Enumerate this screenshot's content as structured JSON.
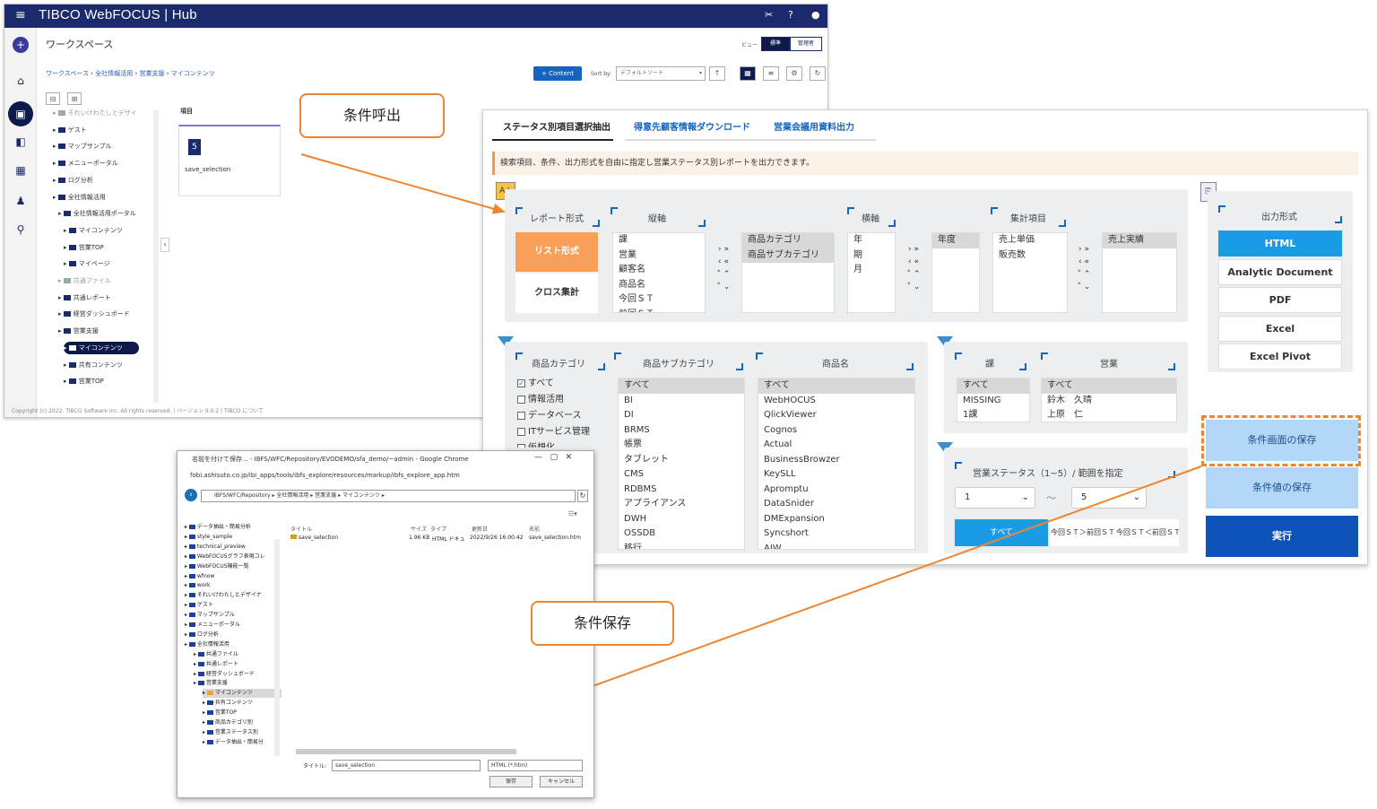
{
  "hub": {
    "brand": "TIBCO WebFOCUS | Hub",
    "workspace_title": "ワークスペース",
    "view_label": "ビュー",
    "view_standard": "標準",
    "view_admin": "管理者",
    "breadcrumb": [
      "ワークスペース",
      "全社情報活用",
      "営業支援",
      "マイコンテンツ"
    ],
    "content_button": "+ Content",
    "sort_label": "Sort by:",
    "sort_value": "デフォルトソート",
    "tree": [
      {
        "label": "それいけわたしとデザイ",
        "level": 1,
        "dim": true
      },
      {
        "label": "ゲスト",
        "level": 1
      },
      {
        "label": "マップサンプル",
        "level": 1
      },
      {
        "label": "メニューポータル",
        "level": 1
      },
      {
        "label": "ログ分析",
        "level": 1
      },
      {
        "label": "全社情報活用",
        "level": 1
      },
      {
        "label": "全社情報活用ポータル",
        "level": 2
      },
      {
        "label": "マイコンテンツ",
        "level": 3
      },
      {
        "label": "営業TOP",
        "level": 3
      },
      {
        "label": "マイページ",
        "level": 3
      },
      {
        "label": "共通ファイル",
        "level": 2,
        "dim": true
      },
      {
        "label": "共通レポート",
        "level": 2
      },
      {
        "label": "経営ダッシュボード",
        "level": 2
      },
      {
        "label": "営業支援",
        "level": 2
      },
      {
        "label": "マイコンテンツ",
        "level": 3,
        "selected": true
      },
      {
        "label": "共有コンテンツ",
        "level": 3
      },
      {
        "label": "営業TOP",
        "level": 3
      }
    ],
    "items_header": "項目",
    "card_icon": "html5-icon",
    "card_name": "save_selection",
    "footer": "Copyright (c) 2022. TIBCO Software Inc. All rights reserved.  |  バージョン 9.0.2  |  TIBCO について"
  },
  "app": {
    "tabs": [
      "ステータス別項目選択抽出",
      "得意先顧客情報ダウンロード",
      "営業会議用資料出力"
    ],
    "description": "検索項目、条件、出力形式を自由に指定し営業ステータス別レポートを出力できます。",
    "report_format_label": "レポート形式",
    "list_format": "リスト形式",
    "cross_format": "クロス集計",
    "vertical_axis_label": "縦軸",
    "vertical_items": [
      "課",
      "営業",
      "顧客名",
      "商品名",
      "今回ＳＴ",
      "前回ＳＴ"
    ],
    "vertical_selected": [
      "商品カテゴリ",
      "商品サブカテゴリ"
    ],
    "horizontal_axis_label": "横軸",
    "horizontal_items": [
      "年",
      "期",
      "月"
    ],
    "horizontal_selected": [
      "年度"
    ],
    "agg_label": "集計項目",
    "agg_items": [
      "売上単価",
      "販売数"
    ],
    "agg_selected": [
      "売上実績"
    ],
    "arrows": [
      "›  »",
      "‹  «",
      "˄  ⌃",
      "˅  ⌄"
    ],
    "output_label": "出力形式",
    "outputs": [
      "HTML",
      "Analytic Document",
      "PDF",
      "Excel",
      "Excel Pivot"
    ],
    "cat_label": "商品カテゴリ",
    "cat_items": [
      {
        "label": "すべて",
        "checked": true
      },
      {
        "label": "情報活用",
        "checked": false
      },
      {
        "label": "データベース",
        "checked": false
      },
      {
        "label": "ITサービス管理",
        "checked": false
      },
      {
        "label": "仮想化",
        "checked": false
      }
    ],
    "subcat_label": "商品サブカテゴリ",
    "subcat_items": [
      "すべて",
      "BI",
      "DI",
      "BRMS",
      "帳票",
      "タブレット",
      "CMS",
      "RDBMS",
      "アプライアンス",
      "DWH",
      "OSSDB",
      "移行"
    ],
    "product_label": "商品名",
    "product_items": [
      "すべて",
      "WebHOCUS",
      "QlickViewer",
      "Cognos",
      "Actual",
      "BusinessBrowzer",
      "KeySLL",
      "Apromptu",
      "DataSnider",
      "DMExpansion",
      "Syncshort",
      "AJW"
    ],
    "section_label": "課",
    "section_items": [
      "すべて",
      "MISSING",
      "1課"
    ],
    "sales_label": "営業",
    "sales_items": [
      "すべて",
      "鈴木　久晴",
      "上原　仁"
    ],
    "status_label": "営業ステータス（1~5）/ 範囲を指定",
    "status_from": "1",
    "status_tilde": "～",
    "status_to": "5",
    "status_tabs": [
      "すべて",
      "今回ＳＴ＞前回ＳＴ",
      "今回ＳＴ＜前回ＳＴ"
    ],
    "save_screen": "条件画面の保存",
    "save_values": "条件値の保存",
    "run": "実行"
  },
  "callouts": {
    "recall": "条件呼出",
    "save": "条件保存"
  },
  "dialog": {
    "title": "名前を付けて保存... - IBFS/WFC/Repository/EVODEMO/sfa_demo/~admin - Google Chrome",
    "url": "fobi.ashisuto.co.jp/ibi_apps/tools/ibfs_explore/resources/markup/ibfs_explore_app.htm",
    "path": "IBFS/WFC/Repository ▸ 全社情報活用 ▸ 営業支援 ▸ マイコンテンツ ▸",
    "tree": [
      {
        "label": "データ抽出・簡易分析",
        "level": 0
      },
      {
        "label": "style_sample",
        "level": 0
      },
      {
        "label": "technical_preview",
        "level": 0
      },
      {
        "label": "WebFOCUSグラフ表現コレ",
        "level": 0
      },
      {
        "label": "WebFOCUS機能一覧",
        "level": 0
      },
      {
        "label": "wfnow",
        "level": 0
      },
      {
        "label": "work",
        "level": 0
      },
      {
        "label": "それいけわたしとデザイナ",
        "level": 0
      },
      {
        "label": "ゲスト",
        "level": 0
      },
      {
        "label": "マップサンプル",
        "level": 0
      },
      {
        "label": "メニューポータル",
        "level": 0
      },
      {
        "label": "ログ分析",
        "level": 0
      },
      {
        "label": "全社情報活用",
        "level": 0
      },
      {
        "label": "共通ファイル",
        "level": 1
      },
      {
        "label": "共通レポート",
        "level": 1
      },
      {
        "label": "経営ダッシュボード",
        "level": 1
      },
      {
        "label": "営業支援",
        "level": 1
      },
      {
        "label": "マイコンテンツ",
        "level": 2,
        "selected": true
      },
      {
        "label": "共有コンテンツ",
        "level": 2
      },
      {
        "label": "営業TOP",
        "level": 2
      },
      {
        "label": "商品カテゴリ別",
        "level": 2
      },
      {
        "label": "営業ステータス別",
        "level": 2
      },
      {
        "label": "データ抽出・簡易分",
        "level": 2
      }
    ],
    "columns": [
      "タイトル",
      "サイズ",
      "タイプ",
      "更新日",
      "名前"
    ],
    "row": {
      "title": "save_selection",
      "size": "1.96 KB",
      "type": "HTML ドキュ",
      "date": "2022/9/26 16:00:42",
      "name": "save_selection.htm"
    },
    "title_label": "タイトル:",
    "title_value": "save_selection",
    "type_value": "HTML (*.htm)",
    "save": "保存",
    "cancel": "キャンセル"
  }
}
